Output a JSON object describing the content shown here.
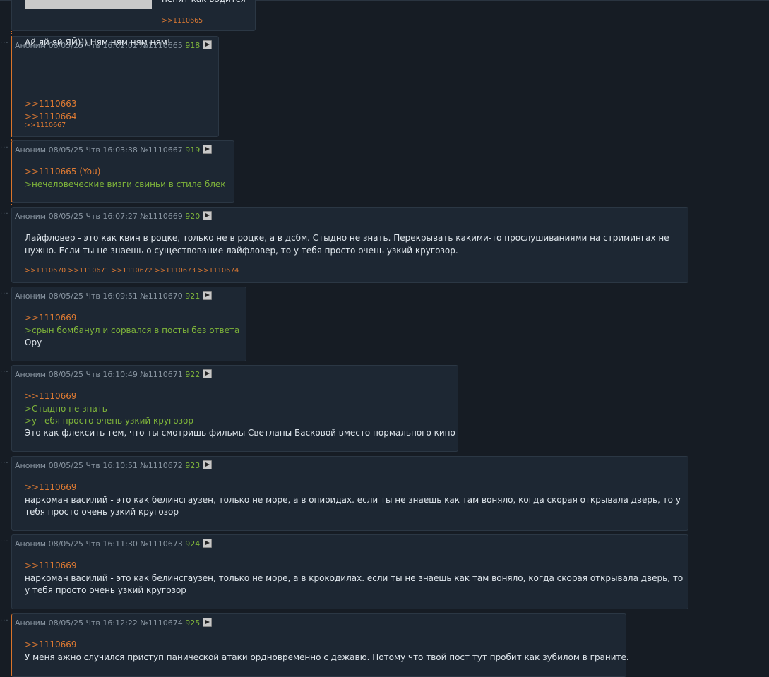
{
  "top_post": {
    "text_partial": "пенит как водится",
    "replies": ">>1110665"
  },
  "posts": [
    {
      "header": "Аноним 08/05/25 Чтв 16:02:02 №1110665",
      "num": "918",
      "lines": [
        ">>1110663",
        ">>1110664",
        "",
        "Ай яй яй ЯЙ))) Ням ням ням ням!"
      ],
      "replies": ">>1110667"
    },
    {
      "header": "Аноним 08/05/25 Чтв 16:03:38 №1110667",
      "num": "919",
      "lines": [
        ">>1110665 (You)",
        ">нечеловеческие визги свиньи в стиле блек"
      ],
      "replies": ""
    },
    {
      "header": "Аноним 08/05/25 Чтв 16:07:27 №1110669",
      "num": "920",
      "lines": [
        "Лайфловер - это как квин в роцке, только не в роцке, а в дсбм. Стыдно не знать. Перекрывать какими-то прослушиваниями на стримингах не",
        "нужно. Если ты не знаешь о существование лайфловер, то у тебя просто очень узкий кругозор."
      ],
      "replies": ">>1110670 >>1110671 >>1110672 >>1110673 >>1110674"
    },
    {
      "header": "Аноним 08/05/25 Чтв 16:09:51 №1110670",
      "num": "921",
      "lines": [
        ">>1110669",
        ">срын бомбанул и сорвался в посты без ответа",
        "Ору"
      ],
      "replies": ""
    },
    {
      "header": "Аноним 08/05/25 Чтв 16:10:49 №1110671",
      "num": "922",
      "lines": [
        ">>1110669",
        ">Стыдно не знать",
        ">у тебя просто очень узкий кругозор",
        "Это как флексить тем, что ты смотришь фильмы Светланы Басковой вместо нормального кино"
      ],
      "replies": ""
    },
    {
      "header": "Аноним 08/05/25 Чтв 16:10:51 №1110672",
      "num": "923",
      "lines": [
        ">>1110669",
        "наркоман василий - это как белинсгаузен, только не море, а в опиоидах. если ты не знаешь как там воняло, когда скорая открывала дверь, то у",
        "тебя просто очень узкий кругозор"
      ],
      "replies": ""
    },
    {
      "header": "Аноним 08/05/25 Чтв 16:11:30 №1110673",
      "num": "924",
      "lines": [
        ">>1110669",
        "наркоман василий - это как белинсгаузен, только не море, а в крокодилах. если ты не знаешь как там воняло, когда скорая открывала дверь, то",
        "у тебя просто очень узкий кругозор"
      ],
      "replies": ""
    },
    {
      "header": "Аноним 08/05/25 Чтв 16:12:22 №1110674",
      "num": "925",
      "lines": [
        ">>1110669",
        "У меня ажно случился приступ панической атаки ордновременно с дежавю. Потому что твой пост тут пробит как зубилом в граните."
      ],
      "replies": ""
    }
  ]
}
